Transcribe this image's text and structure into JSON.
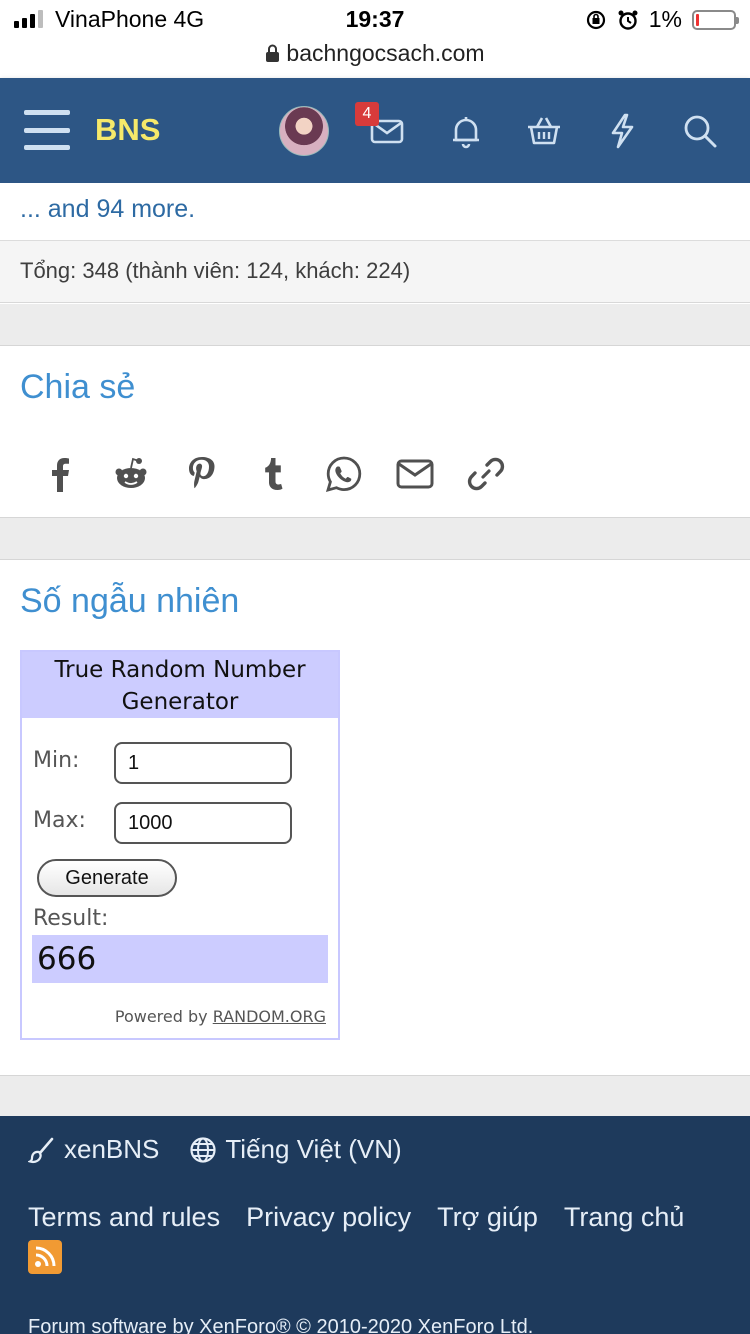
{
  "status": {
    "carrier": "VinaPhone  4G",
    "time": "19:37",
    "battery": "1%",
    "url": "bachngocsach.com"
  },
  "header": {
    "logo": "BNS",
    "inbox_badge": "4"
  },
  "online": {
    "more_link": "... and 94 more.",
    "total": "Tổng: 348 (thành viên: 124, khách: 224)"
  },
  "share": {
    "title": "Chia sẻ",
    "icons": [
      "facebook-icon",
      "reddit-icon",
      "pinterest-icon",
      "tumblr-icon",
      "whatsapp-icon",
      "email-icon",
      "link-icon"
    ]
  },
  "random": {
    "title": "Số ngẫu nhiên",
    "widget_title": "True Random Number Generator",
    "min_label": "Min:",
    "min_value": "1",
    "max_label": "Max:",
    "max_value": "1000",
    "generate_label": "Generate",
    "result_label": "Result:",
    "result_value": "666",
    "powered_prefix": "Powered by",
    "powered_link": "RANDOM.ORG"
  },
  "footer": {
    "style": "xenBNS",
    "language": "Tiếng Việt (VN)",
    "links": [
      "Terms and rules",
      "Privacy policy",
      "Trợ giúp",
      "Trang chủ"
    ],
    "copyright": "Forum software by XenForo® © 2010-2020 XenForo Ltd."
  },
  "colors": {
    "header_bg": "#2d5685",
    "logo": "#f6e96a",
    "title_blue": "#3f8fd0",
    "footer_bg": "#1e3a5c",
    "widget_accent": "#ccccff"
  }
}
